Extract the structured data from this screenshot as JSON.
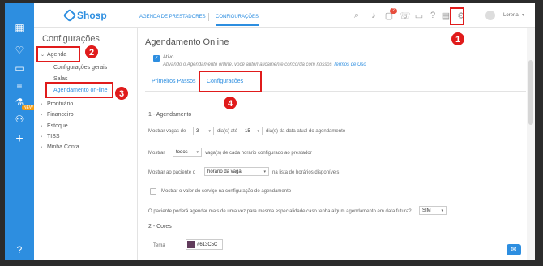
{
  "topbar": {
    "logo": "Shosp",
    "tabs": [
      "AGENDA DE PRESTADORES",
      "CONFIGURAÇÕES"
    ],
    "notification_count": "2",
    "user_name": "Lorena"
  },
  "sidebar": {
    "title": "Configurações",
    "items": [
      {
        "label": "Agenda"
      },
      {
        "label": "Configurações gerais"
      },
      {
        "label": "Salas"
      },
      {
        "label": "Agendamento on-line"
      },
      {
        "label": "Prontuário"
      },
      {
        "label": "Financeiro"
      },
      {
        "label": "Estoque"
      },
      {
        "label": "TISS"
      },
      {
        "label": "Minha Conta"
      }
    ],
    "rail_badge": "NEW"
  },
  "main": {
    "title": "Agendamento Online",
    "active_label": "Ativo",
    "active_note": "Ativando o Agendamento online, você automaticamente concorda com nossos",
    "terms_link": "Termos de Uso",
    "tabs": [
      "Primeiros Passos",
      "Configurações"
    ],
    "section1": "1 - Agendamento",
    "row1": {
      "pre": "Mostrar vagas de",
      "val1": "3",
      "mid": "dia(s) até",
      "val2": "15",
      "post": "dia(s) da data atual do agendamento"
    },
    "row2": {
      "pre": "Mostrar",
      "val": "todos",
      "post": "vaga(s) de cada horário configurado ao prestador"
    },
    "row3": {
      "pre": "Mostrar ao paciente o",
      "val": "horário da vaga",
      "post": "na lista de horários disponíveis"
    },
    "row4": "Mostrar o valor do serviço na configuração do agendamento",
    "row5": {
      "text": "O paciente poderá agendar mais de uma vez para mesma especialidade caso tenha algum agendamento em data futura?",
      "val": "SIM"
    },
    "section2": "2 - Cores",
    "theme_label": "Tema",
    "theme_value": "#613C5C",
    "theme_color": "#613c5c"
  },
  "annotations": [
    "1",
    "2",
    "3",
    "4"
  ],
  "accent": "#2d8ee0"
}
